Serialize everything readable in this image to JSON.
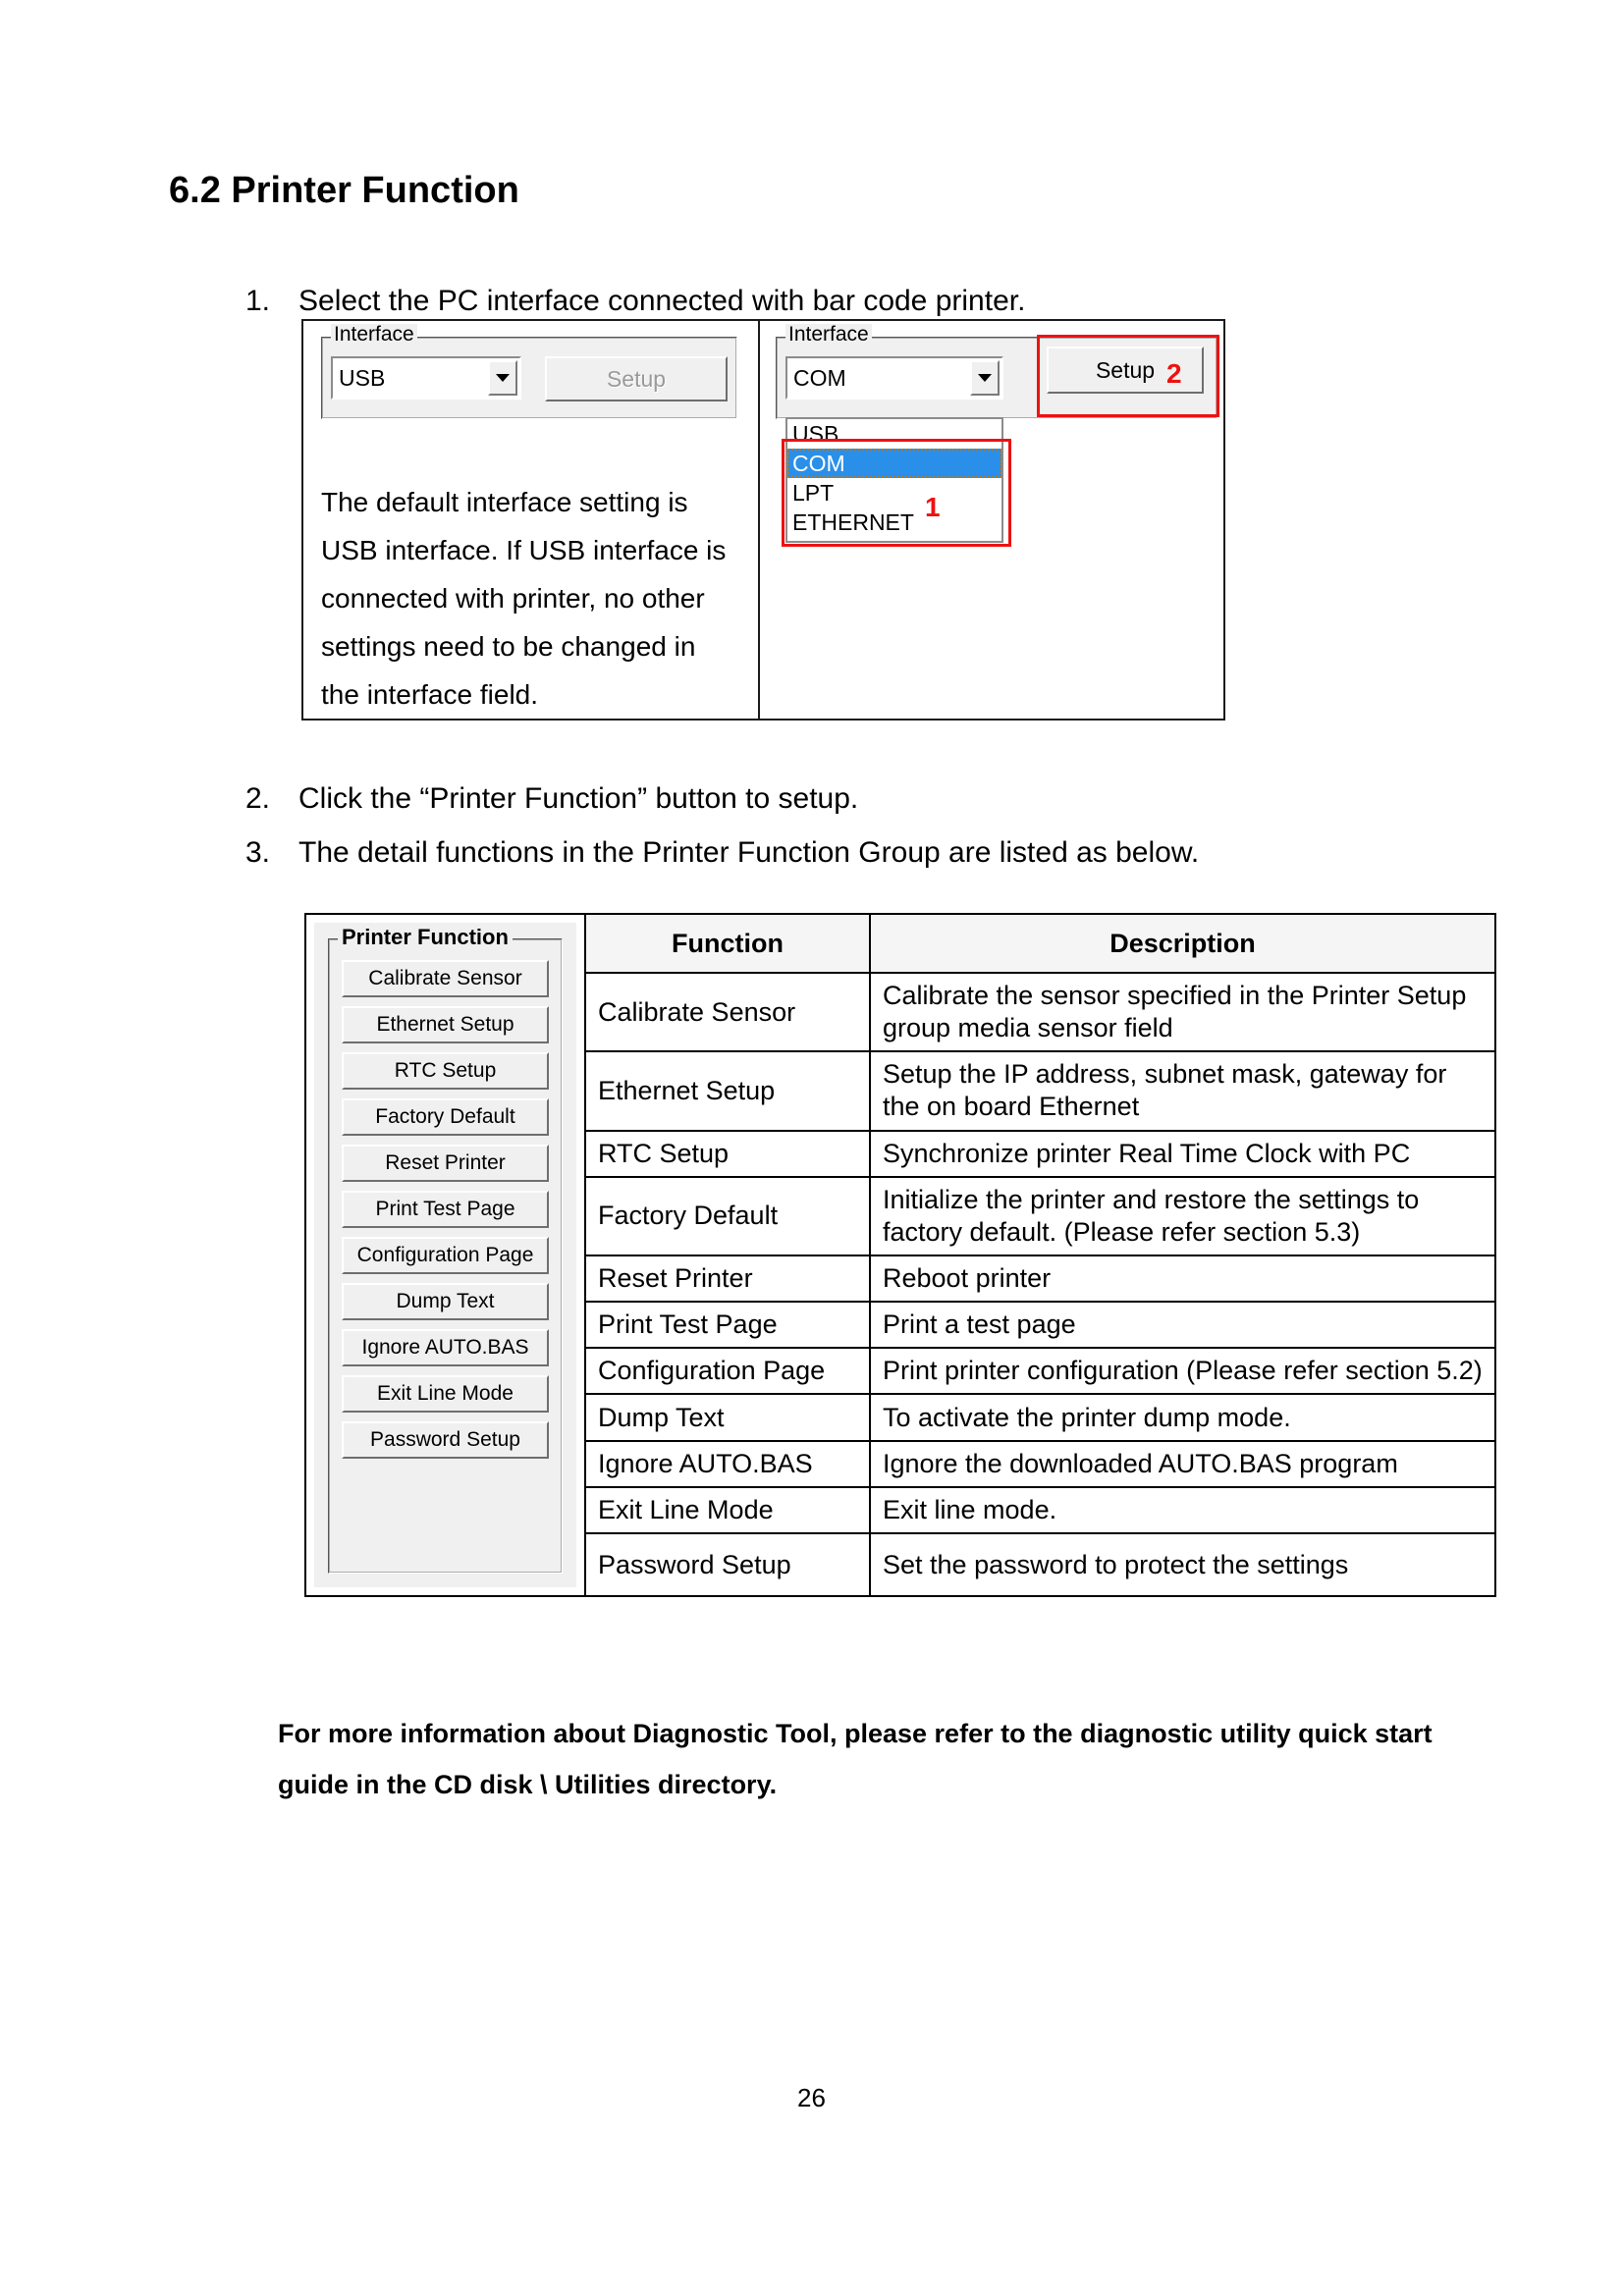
{
  "document": {
    "section_title": "6.2 Printer Function",
    "page_number": "26"
  },
  "steps": [
    {
      "num": "1.",
      "text": "Select the PC interface connected with bar code printer."
    },
    {
      "num": "2.",
      "text": "Click the “Printer Function” button to setup."
    },
    {
      "num": "3.",
      "text": "The detail functions in the Printer Function Group are listed as below."
    }
  ],
  "interface_figure": {
    "left_panel": {
      "groupbox_legend": "Interface",
      "combo_value": "USB",
      "setup_button_label": "Setup",
      "note": "The default interface setting is USB interface. If USB interface is connected with printer, no other settings need to be changed in the interface field."
    },
    "right_panel": {
      "groupbox_legend": "Interface",
      "combo_value": "COM",
      "setup_button_label": "Setup",
      "dropdown_options": [
        "USB",
        "COM",
        "LPT",
        "ETHERNET"
      ],
      "selected_option": "COM",
      "annotations": [
        {
          "label": "1",
          "target": "dropdown-list"
        },
        {
          "label": "2",
          "target": "setup-button"
        }
      ],
      "annotation_color": "#ee1111",
      "selection_color": "#2a8fe8"
    }
  },
  "printer_function_panel": {
    "legend": "Printer Function",
    "buttons": [
      "Calibrate Sensor",
      "Ethernet Setup",
      "RTC Setup",
      "Factory Default",
      "Reset Printer",
      "Print Test Page",
      "Configuration Page",
      "Dump Text",
      "Ignore AUTO.BAS",
      "Exit Line Mode",
      "Password Setup"
    ]
  },
  "function_table": {
    "headers": [
      "Function",
      "Description"
    ],
    "rows": [
      {
        "function": "Calibrate Sensor",
        "description": "Calibrate the sensor specified in the Printer Setup group media sensor field"
      },
      {
        "function": "Ethernet Setup",
        "description": "Setup the IP address, subnet mask, gateway for the on board Ethernet"
      },
      {
        "function": "RTC Setup",
        "description": "Synchronize printer Real Time Clock with PC"
      },
      {
        "function": "Factory Default",
        "description": "Initialize the printer and restore the settings to factory default. (Please refer section 5.3)"
      },
      {
        "function": "Reset Printer",
        "description": "Reboot printer"
      },
      {
        "function": "Print Test Page",
        "description": "Print a test page"
      },
      {
        "function": "Configuration Page",
        "description": "Print printer configuration (Please refer section 5.2)"
      },
      {
        "function": "Dump Text",
        "description": "To activate the printer dump mode."
      },
      {
        "function": "Ignore AUTO.BAS",
        "description": "Ignore the downloaded AUTO.BAS program"
      },
      {
        "function": "Exit Line Mode",
        "description": "Exit line mode."
      },
      {
        "function": "Password Setup",
        "description": "Set the password to protect the settings"
      }
    ]
  },
  "footer_note": "For more information about Diagnostic Tool, please refer to the diagnostic utility quick start guide in the CD disk \\ Utilities directory."
}
